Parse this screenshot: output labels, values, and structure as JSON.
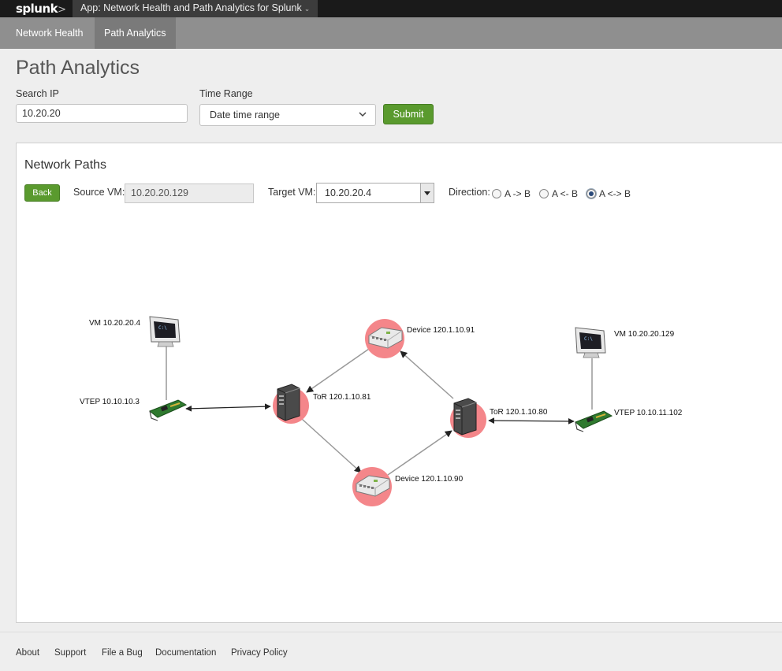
{
  "header": {
    "logo": "splunk",
    "logo_mark": ">",
    "app_label": "App: Network Health and Path Analytics for Splunk"
  },
  "nav": {
    "tabs": [
      {
        "label": "Network Health",
        "active": false
      },
      {
        "label": "Path Analytics",
        "active": true
      }
    ]
  },
  "page": {
    "title": "Path Analytics"
  },
  "search": {
    "label": "Search IP",
    "value": "10.20.20",
    "time_label": "Time Range",
    "time_value": "Date time range",
    "submit_label": "Submit"
  },
  "panel": {
    "title": "Network Paths",
    "back_label": "Back",
    "source_label": "Source VM:",
    "source_value": "10.20.20.129",
    "target_label": "Target VM:",
    "target_value": "10.20.20.4",
    "direction_label": "Direction:",
    "directions": [
      {
        "label": "A -> B",
        "checked": false
      },
      {
        "label": "A <- B",
        "checked": false
      },
      {
        "label": "A <-> B",
        "checked": true
      }
    ]
  },
  "graph": {
    "nodes": {
      "vm_a": "VM 10.20.20.4",
      "vtep_a": "VTEP 10.10.10.3",
      "tor_a": "ToR 120.1.10.81",
      "dev_top": "Device 120.1.10.91",
      "dev_bottom": "Device 120.1.10.90",
      "tor_b": "ToR 120.1.10.80",
      "vm_b": "VM 10.20.20.129",
      "vtep_b": "VTEP 10.10.11.102"
    },
    "highlight_color": "#f4868a",
    "edge_color": "#999999"
  },
  "footer": {
    "links": [
      "About",
      "Support",
      "File a Bug",
      "Documentation",
      "Privacy Policy"
    ]
  },
  "colors": {
    "accent_green": "#5a9a2e",
    "topbar": "#1a1a1a",
    "navbar": "#8f8f8f"
  }
}
